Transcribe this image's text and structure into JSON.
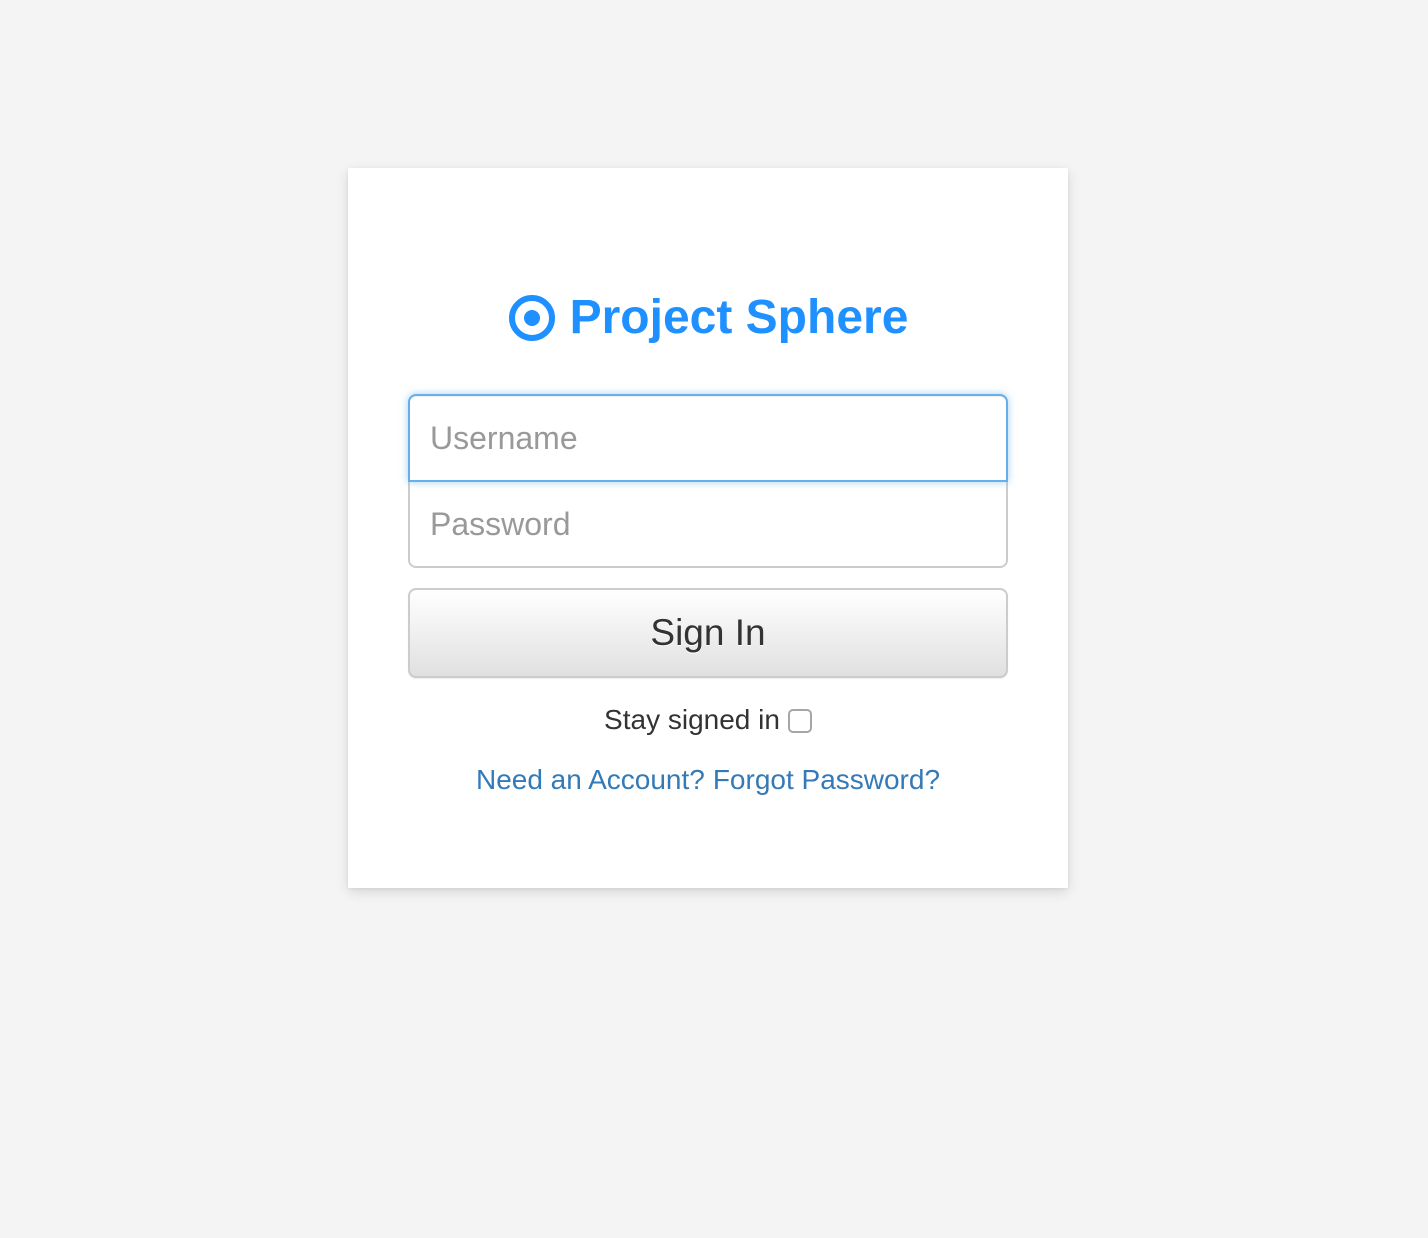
{
  "brand": {
    "title": "Project Sphere",
    "icon": "dot-circle-icon",
    "color": "#1e90ff"
  },
  "form": {
    "username_placeholder": "Username",
    "username_value": "",
    "password_placeholder": "Password",
    "password_value": "",
    "submit_label": "Sign In",
    "remember_label": "Stay signed in",
    "remember_checked": false
  },
  "links": {
    "need_account": "Need an Account?",
    "forgot_password": "Forgot Password?",
    "link_color": "#337ab7"
  },
  "colors": {
    "page_background": "#f4f4f4",
    "card_background": "#ffffff",
    "focus_border": "#66afe9"
  }
}
